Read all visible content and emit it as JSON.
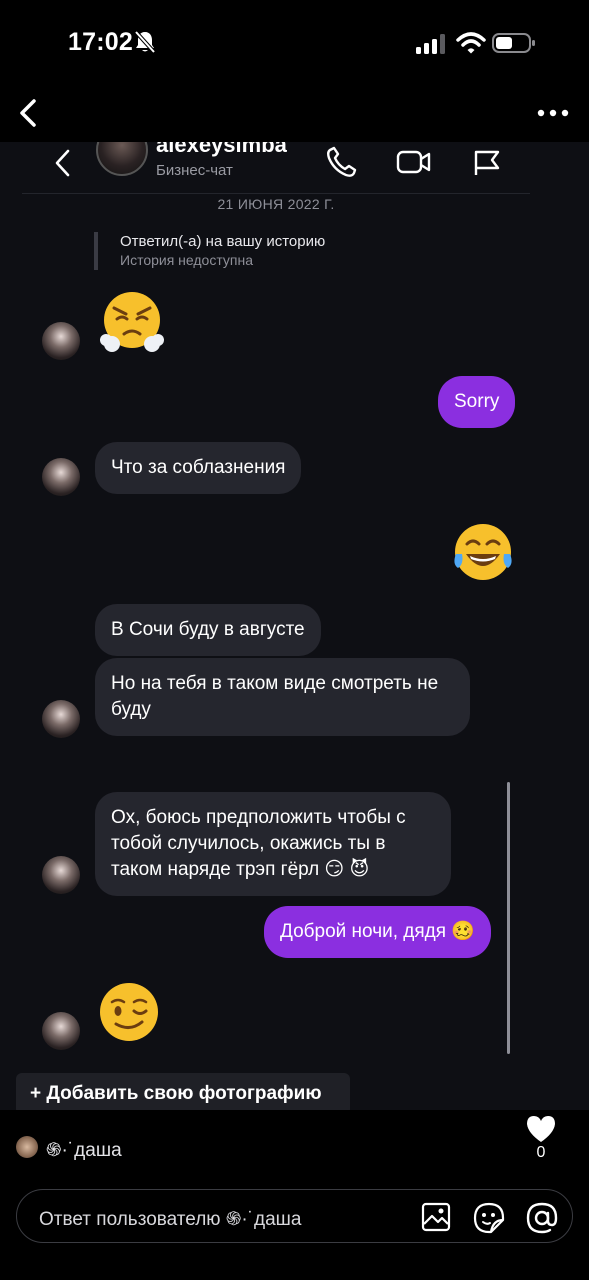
{
  "status_bar": {
    "time": "17:02"
  },
  "story_top": {
    "back_icon": "chevron-left-icon",
    "more_icon": "more-horizontal-icon"
  },
  "chat": {
    "header": {
      "name": "alexeysimba",
      "subtitle": "Бизнес-чат"
    },
    "date_separator": "21 ИЮНЯ 2022 Г.",
    "story_reply": {
      "title": "Ответил(-а) на вашу историю",
      "subtitle": "История недоступна"
    },
    "messages": [
      {
        "from": "them",
        "type": "emoji",
        "emoji": "face-with-steam-from-nose"
      },
      {
        "from": "me",
        "type": "text",
        "text": "Sorry"
      },
      {
        "from": "them",
        "type": "text",
        "text": "Что за соблазнения"
      },
      {
        "from": "me",
        "type": "emoji",
        "emoji": "face-with-tears-of-joy"
      },
      {
        "from": "them",
        "type": "text",
        "text": "В Сочи буду в августе"
      },
      {
        "from": "them",
        "type": "text",
        "text": "Но на тебя в таком виде смотреть не буду"
      },
      {
        "from": "them",
        "type": "text",
        "text": "Ох, боюсь предположить чтобы с тобой случилось, окажись ты в таком наряде трэп гёрл 😏 😈"
      },
      {
        "from": "me",
        "type": "text",
        "text": "Доброй ночи, дядя 🥴"
      },
      {
        "from": "them",
        "type": "emoji",
        "emoji": "winking-face"
      }
    ],
    "add_photo_button": "+ Добавить свою фотографию"
  },
  "footer": {
    "viewer_name": "֍·˙даша",
    "like_count": "0",
    "reply_placeholder": "Ответ пользователю ֍·˙даша"
  },
  "colors": {
    "outgoing_bubble": "#8b2fe0",
    "incoming_bubble": "#25262e",
    "chat_background": "#0e0f14"
  }
}
